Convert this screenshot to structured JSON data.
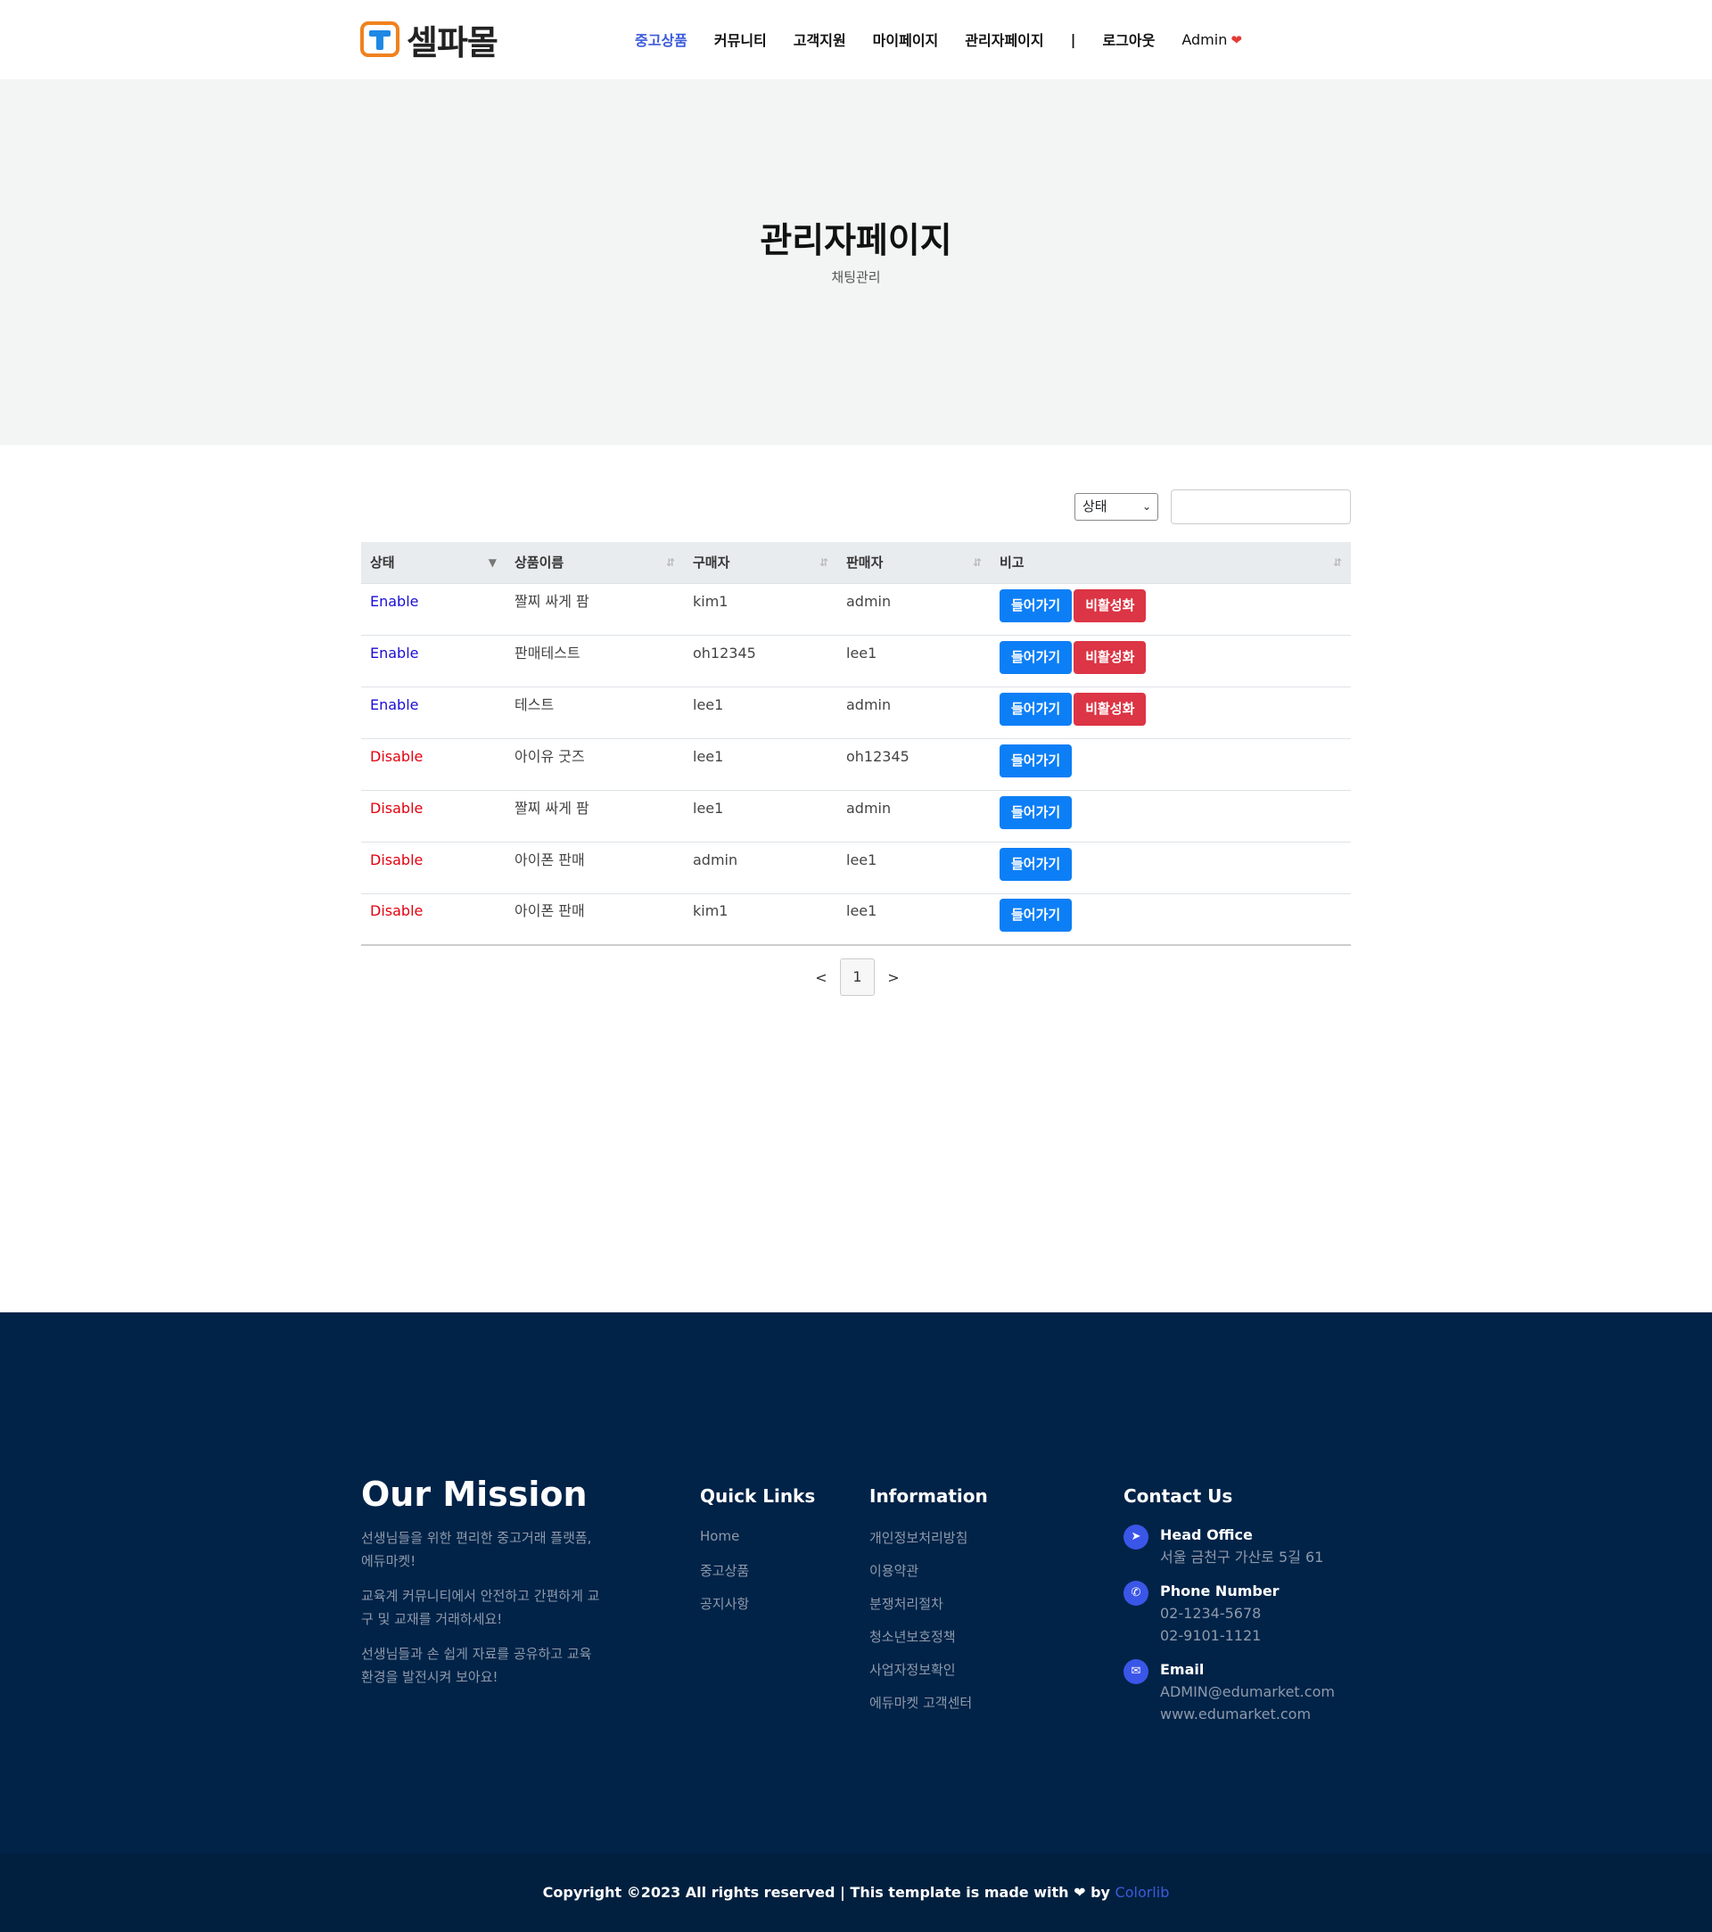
{
  "brand": {
    "name": "셀파몰"
  },
  "nav": {
    "items": [
      "중고상품",
      "커뮤니티",
      "고객지원",
      "마이페이지",
      "관리자페이지",
      "|",
      "로그아웃",
      "Admin"
    ],
    "active_index": 0
  },
  "hero": {
    "title": "관리자페이지",
    "subtitle": "채팅관리"
  },
  "filter": {
    "select_value": "상태",
    "search_value": ""
  },
  "table": {
    "headers": [
      "상태",
      "상품이름",
      "구매자",
      "판매자",
      "비고"
    ],
    "enter_label": "들어가기",
    "disable_label": "비활성화",
    "rows": [
      {
        "status": "Enable",
        "product": "짤찌 싸게 팜",
        "buyer": "kim1",
        "seller": "admin"
      },
      {
        "status": "Enable",
        "product": "판매테스트",
        "buyer": "oh12345",
        "seller": "lee1"
      },
      {
        "status": "Enable",
        "product": "테스트",
        "buyer": "lee1",
        "seller": "admin"
      },
      {
        "status": "Disable",
        "product": "아이유 굿즈",
        "buyer": "lee1",
        "seller": "oh12345"
      },
      {
        "status": "Disable",
        "product": "짤찌 싸게 팜",
        "buyer": "lee1",
        "seller": "admin"
      },
      {
        "status": "Disable",
        "product": "아이폰 판매",
        "buyer": "admin",
        "seller": "lee1"
      },
      {
        "status": "Disable",
        "product": "아이폰 판매",
        "buyer": "kim1",
        "seller": "lee1"
      }
    ]
  },
  "pagination": {
    "prev": "<",
    "current": "1",
    "next": ">"
  },
  "footer": {
    "mission": {
      "title": "Our Mission",
      "paragraphs": [
        "선생님들을 위한 편리한 중고거래 플랫폼, 에듀마켓!",
        "교육계 커뮤니티에서 안전하고 간편하게 교구 및 교재를 거래하세요!",
        "선생님들과 손 쉽게 자료를 공유하고 교육 환경을 발전시켜 보아요!"
      ]
    },
    "quick_links": {
      "title": "Quick Links",
      "items": [
        "Home",
        "중고상품",
        "공지사항"
      ]
    },
    "information": {
      "title": "Information",
      "items": [
        "개인정보처리방침",
        "이용약관",
        "분쟁처리절차",
        "청소년보호정책",
        "사업자정보확인",
        "에듀마켓 고객센터"
      ]
    },
    "contact": {
      "title": "Contact Us",
      "head_office": {
        "label": "Head Office",
        "lines": [
          "서울 금천구 가산로 5길 61"
        ]
      },
      "phone": {
        "label": "Phone Number",
        "lines": [
          "02-1234-5678",
          "02-9101-1121"
        ]
      },
      "email": {
        "label": "Email",
        "lines": [
          "ADMIN@edumarket.com",
          "www.edumarket.com"
        ]
      }
    },
    "copyright": {
      "text": "Copyright ©2023 All rights reserved | This template is made with",
      "by": "by",
      "link": "Colorlib"
    }
  },
  "colors": {
    "accent": "#3b5bdb",
    "enable": "#1a0dd6",
    "disable": "#e3000f",
    "button_blue": "#0d7ff6",
    "button_red": "#dc3545",
    "footer_bg": "#012348"
  },
  "icons": [
    "logo-t-icon",
    "heart-icon",
    "sort-icon",
    "location-arrow-icon",
    "phone-icon",
    "envelope-icon"
  ]
}
